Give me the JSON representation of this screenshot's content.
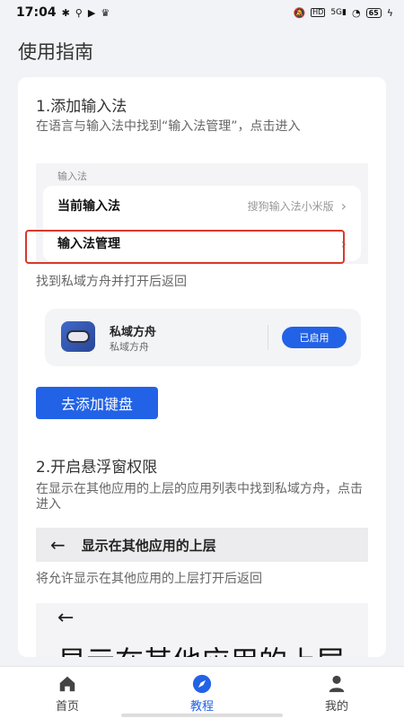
{
  "status_bar": {
    "time": "17:04",
    "left_icons": [
      "gear-icon",
      "usb-icon",
      "video-icon",
      "crown-icon"
    ],
    "right_icons": [
      "mute-icon",
      "hd-icon",
      "signal-5g-icon",
      "wifi-icon"
    ],
    "battery": "65"
  },
  "page": {
    "title": "使用指南"
  },
  "step1": {
    "title": "1.添加输入法",
    "desc": "在语言与输入法中找到“输入法管理”，点击进入",
    "settings": {
      "section_label": "输入法",
      "rows": [
        {
          "label": "当前输入法",
          "value": "搜狗输入法小米版"
        },
        {
          "label": "输入法管理",
          "value": ""
        }
      ]
    },
    "instruction": "找到私域方舟并打开后返回",
    "app": {
      "name": "私域方舟",
      "subtitle": "私域方舟",
      "status": "已启用"
    },
    "button": "去添加键盘"
  },
  "step2": {
    "title": "2.开启悬浮窗权限",
    "desc": "在显示在其他应用的上层的应用列表中找到私域方舟，点击进入",
    "bar_title": "显示在其他应用的上层",
    "instruction": "将允许显示在其他应用的上层打开后返回",
    "preview_title": "显示在其他应用的上层"
  },
  "tabs": [
    {
      "label": "首页",
      "icon": "home-icon",
      "active": false
    },
    {
      "label": "教程",
      "icon": "compass-icon",
      "active": true
    },
    {
      "label": "我的",
      "icon": "person-icon",
      "active": false
    }
  ],
  "colors": {
    "accent": "#2262e6",
    "highlight_border": "#d73a2b"
  }
}
